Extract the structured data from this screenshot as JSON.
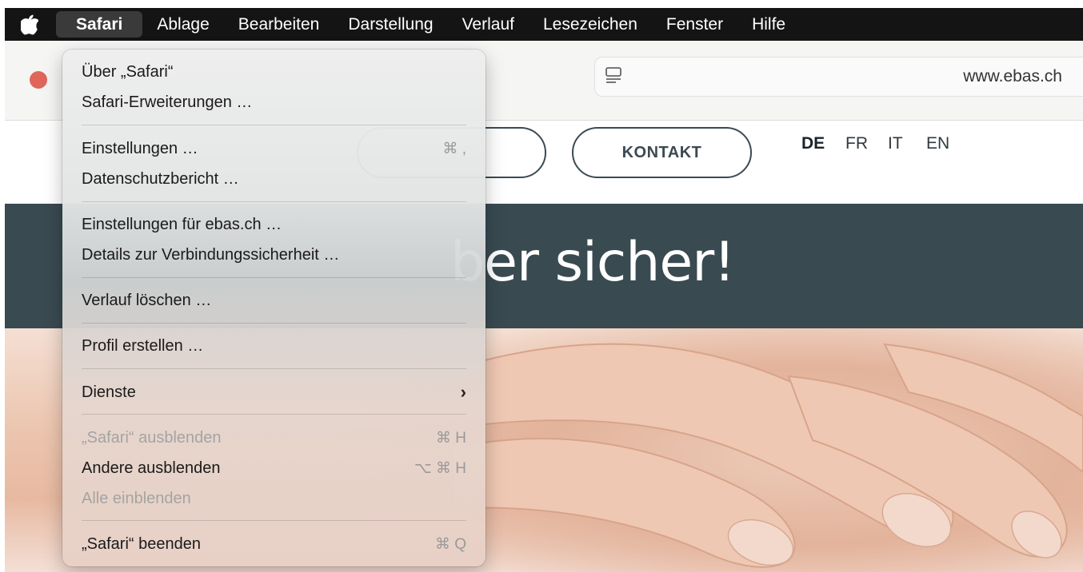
{
  "menubar": {
    "items": [
      "Safari",
      "Ablage",
      "Bearbeiten",
      "Darstellung",
      "Verlauf",
      "Lesezeichen",
      "Fenster",
      "Hilfe"
    ]
  },
  "toolbar": {
    "url": "www.ebas.ch"
  },
  "page": {
    "contact_label": "KONTAKT",
    "languages": [
      "DE",
      "FR",
      "IT",
      "EN"
    ],
    "hero_text": "ber sicher!"
  },
  "menu": {
    "items": [
      {
        "label": "Über „Safari“",
        "shortcut": ""
      },
      {
        "label": "Safari-Erweiterungen …",
        "shortcut": ""
      },
      {
        "label": "Einstellungen …",
        "shortcut": "⌘ ,"
      },
      {
        "label": "Datenschutzbericht …",
        "shortcut": ""
      },
      {
        "label": "Einstellungen für ebas.ch …",
        "shortcut": ""
      },
      {
        "label": "Details zur Verbindungssicherheit …",
        "shortcut": ""
      },
      {
        "label": "Verlauf löschen …",
        "shortcut": ""
      },
      {
        "label": "Profil erstellen …",
        "shortcut": ""
      },
      {
        "label": "Dienste",
        "shortcut": ""
      },
      {
        "label": "„Safari“ ausblenden",
        "shortcut": "⌘ H"
      },
      {
        "label": "Andere ausblenden",
        "shortcut": "⌥ ⌘ H"
      },
      {
        "label": "Alle einblenden",
        "shortcut": ""
      },
      {
        "label": "„Safari“ beenden",
        "shortcut": "⌘ Q"
      }
    ]
  }
}
